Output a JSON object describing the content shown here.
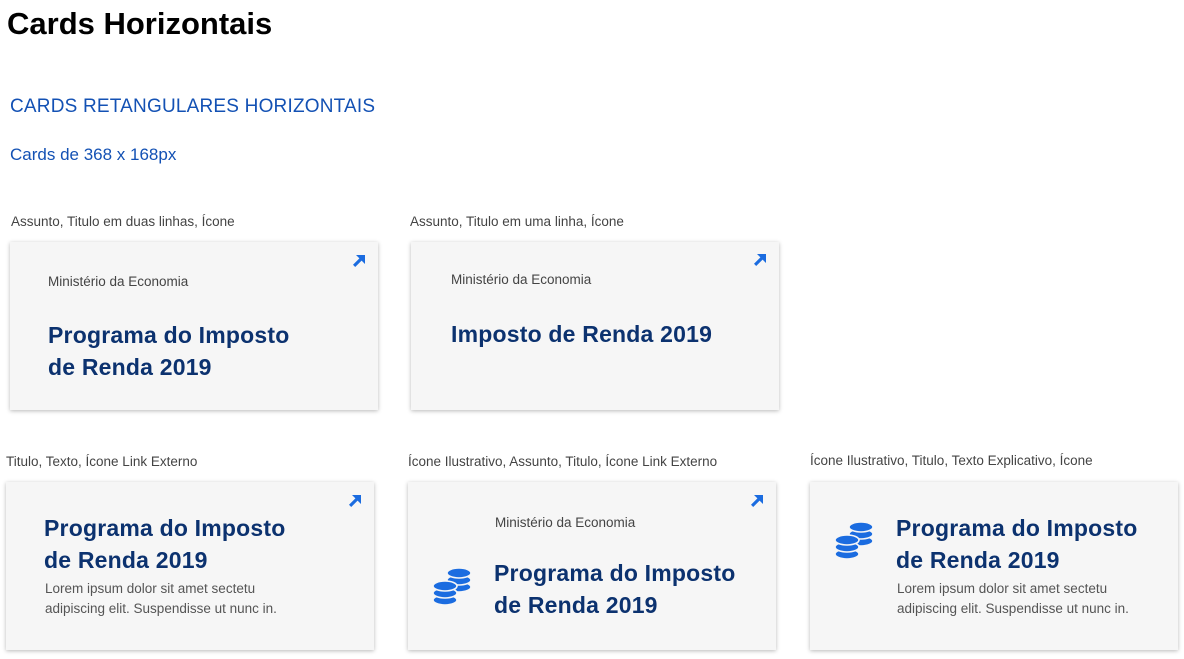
{
  "page": {
    "title": "Cards Horizontais",
    "section_title": "CARDS RETANGULARES HORIZONTAIS",
    "section_subtitle": "Cards de 368 x 168px"
  },
  "colors": {
    "accent": "#1351b4",
    "title": "#0c326f",
    "icon": "#1b6ce0",
    "card_bg": "#f6f6f6"
  },
  "cards": [
    {
      "caption": "Assunto, Titulo em duas linhas, Ícone",
      "subject": "Ministério da Economia",
      "title_line1": "Programa do Imposto",
      "title_line2": "de Renda 2019",
      "corner_icon": "external-link-arrow-icon"
    },
    {
      "caption": "Assunto, Titulo em uma linha, Ícone",
      "subject": "Ministério da Economia",
      "title_line1": "Imposto de Renda 2019",
      "corner_icon": "external-link-arrow-icon"
    },
    {
      "caption": "Titulo, Texto, Ícone Link Externo",
      "title_line1": "Programa do Imposto",
      "title_line2": "de Renda 2019",
      "text_line1": "Lorem ipsum dolor sit amet sectetu",
      "text_line2": "adipiscing elit. Suspendisse ut nunc in.",
      "corner_icon": "external-link-arrow-icon"
    },
    {
      "caption": "Ícone Ilustrativo, Assunto, Titulo, Ícone Link Externo",
      "subject": "Ministério da Economia",
      "title_line1": "Programa do Imposto",
      "title_line2": "de Renda 2019",
      "illustrative_icon": "coins-icon",
      "corner_icon": "external-link-arrow-icon"
    },
    {
      "caption": "Ícone Ilustrativo, Titulo, Texto Explicativo, Ícone",
      "title_line1": "Programa do Imposto",
      "title_line2": "de Renda 2019",
      "text_line1": "Lorem ipsum dolor sit amet sectetu",
      "text_line2": "adipiscing elit. Suspendisse ut nunc in.",
      "illustrative_icon": "coins-icon"
    }
  ]
}
